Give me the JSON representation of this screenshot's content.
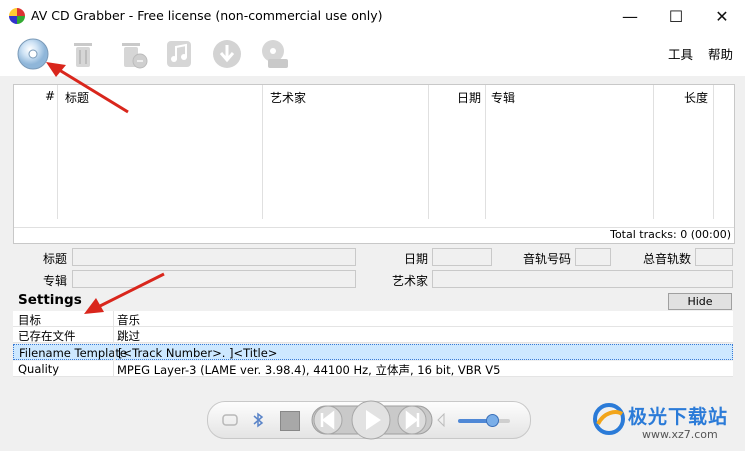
{
  "window": {
    "title": "AV CD Grabber - Free license (non-commercial use only)",
    "minimize_glyph": "—",
    "maximize_glyph": "☐",
    "close_glyph": "✕"
  },
  "toolbar": {
    "buttons": [
      "cd-icon",
      "trash-icon",
      "trash-clear-icon",
      "music-note-icon",
      "download-icon",
      "disc-save-icon"
    ]
  },
  "menu": {
    "tools": "工具",
    "help": "帮助"
  },
  "track_grid": {
    "columns": [
      "#",
      "标题",
      "艺术家",
      "日期",
      "专辑",
      "长度"
    ],
    "total_tracks": "Total tracks: 0 (00:00)"
  },
  "album_info": {
    "title_label": "标题",
    "date_label": "日期",
    "track_no_label": "音轨号码",
    "total_tracks_label": "总音轨数",
    "album_label": "专辑",
    "artist_label": "艺术家"
  },
  "settings": {
    "header": "Settings",
    "hide_label": "Hide",
    "rows": [
      {
        "key": "目标",
        "value": "音乐"
      },
      {
        "key": "已存在文件",
        "value": "跳过"
      },
      {
        "key": "Filename Template",
        "value": "[<Track Number>. ]<Title>"
      },
      {
        "key": "Quality",
        "value": "MPEG Layer-3 (LAME ver. 3.98.4), 44100 Hz, 立体声, 16 bit, VBR V5"
      }
    ]
  },
  "watermark": {
    "text": "极光下载站",
    "url": "www.xz7.com"
  },
  "colors": {
    "accent_arrow": "#d9261c",
    "selection": "#cde8ff",
    "watermark_blue": "#2b7bd8"
  }
}
